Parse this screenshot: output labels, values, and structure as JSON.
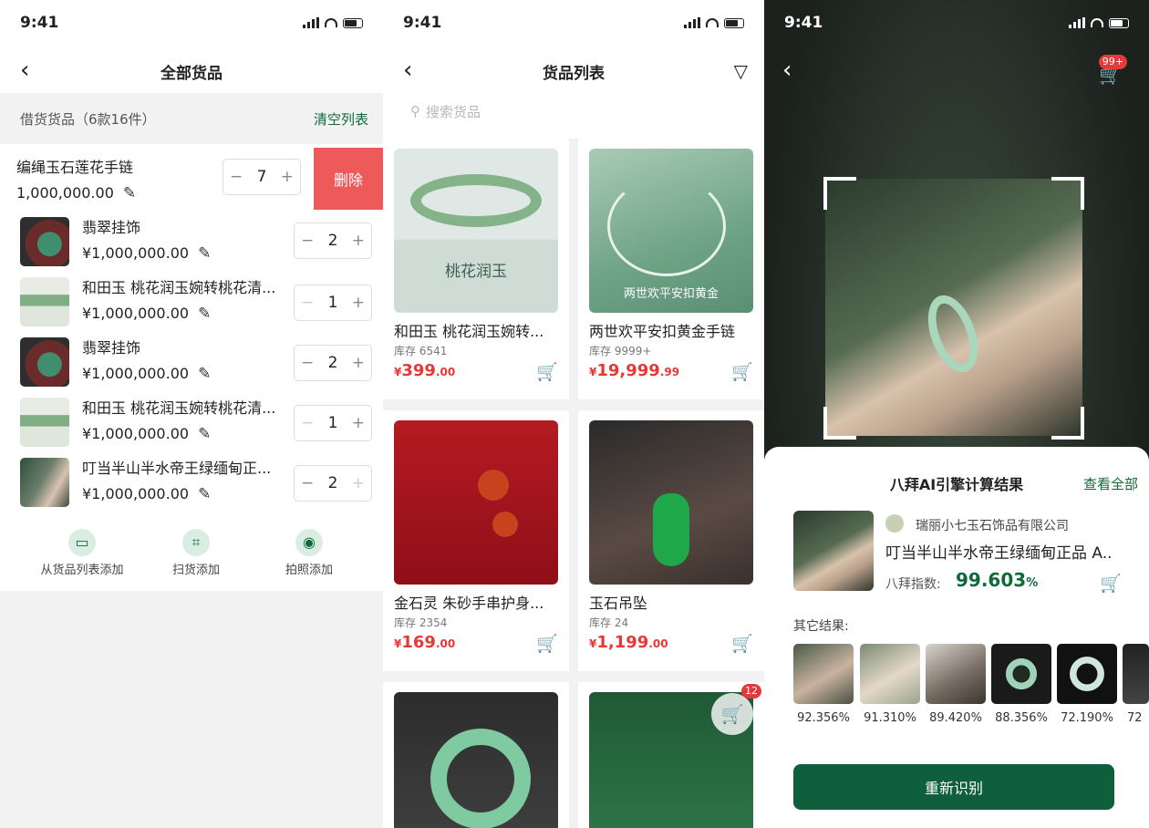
{
  "status_bar": {
    "time": "9:41"
  },
  "screen1": {
    "title": "全部货品",
    "header_label": "借货货品（6款16件）",
    "clear_label": "清空列表",
    "delete_label": "删除",
    "items": [
      {
        "name": "编绳玉石莲花手链",
        "price": "1,000,000.00",
        "qty": "7"
      },
      {
        "name": "翡翠挂饰",
        "price": "¥1,000,000.00",
        "qty": "2"
      },
      {
        "name": "和田玉 桃花润玉婉转桃花清...",
        "price": "¥1,000,000.00",
        "qty": "1"
      },
      {
        "name": "翡翠挂饰",
        "price": "¥1,000,000.00",
        "qty": "2"
      },
      {
        "name": "和田玉 桃花润玉婉转桃花清...",
        "price": "¥1,000,000.00",
        "qty": "1"
      },
      {
        "name": "叮当半山半水帝王绿缅甸正...",
        "price": "¥1,000,000.00",
        "qty": "2"
      }
    ],
    "actions": [
      {
        "label": "从货品列表添加",
        "icon": "wallet-icon"
      },
      {
        "label": "扫货添加",
        "icon": "scan-icon"
      },
      {
        "label": "拍照添加",
        "icon": "camera-icon"
      }
    ]
  },
  "screen2": {
    "title": "货品列表",
    "search_placeholder": "搜索货品",
    "products": [
      {
        "name": "和田玉 桃花润玉婉转...",
        "stock": "库存 6541",
        "price_int": "399",
        "price_dec": ".00",
        "pic_text": "桃花润玉"
      },
      {
        "name": "两世欢平安扣黄金手链",
        "stock": "库存 9999+",
        "price_int": "19,999",
        "price_dec": ".99",
        "pic_text": "两世欢平安扣黄金"
      },
      {
        "name": "金石灵 朱砂手串护身...",
        "stock": "库存 2354",
        "price_int": "169",
        "price_dec": ".00"
      },
      {
        "name": "玉石吊坠",
        "stock": "库存 24",
        "price_int": "1,199",
        "price_dec": ".00"
      }
    ],
    "cart_badge": "12"
  },
  "screen3": {
    "cart_badge": "99+",
    "result_title": "八拜AI引擎计算结果",
    "view_all": "查看全部",
    "shop": "瑞丽小七玉石饰品有限公司",
    "product": "叮当半山半水帝王绿缅甸正品 A...",
    "index_label": "八拜指数:",
    "index_value": "99.603",
    "index_unit": "%",
    "other_label": "其它结果:",
    "others": [
      "92.356%",
      "91.310%",
      "89.420%",
      "88.356%",
      "72.190%",
      "72"
    ],
    "retry": "重新识别"
  },
  "colors": {
    "brand_green": "#0f5e3c",
    "accent_red": "#ee5a5a",
    "cart_yellow": "#e6a214",
    "price_red": "#e53935"
  }
}
